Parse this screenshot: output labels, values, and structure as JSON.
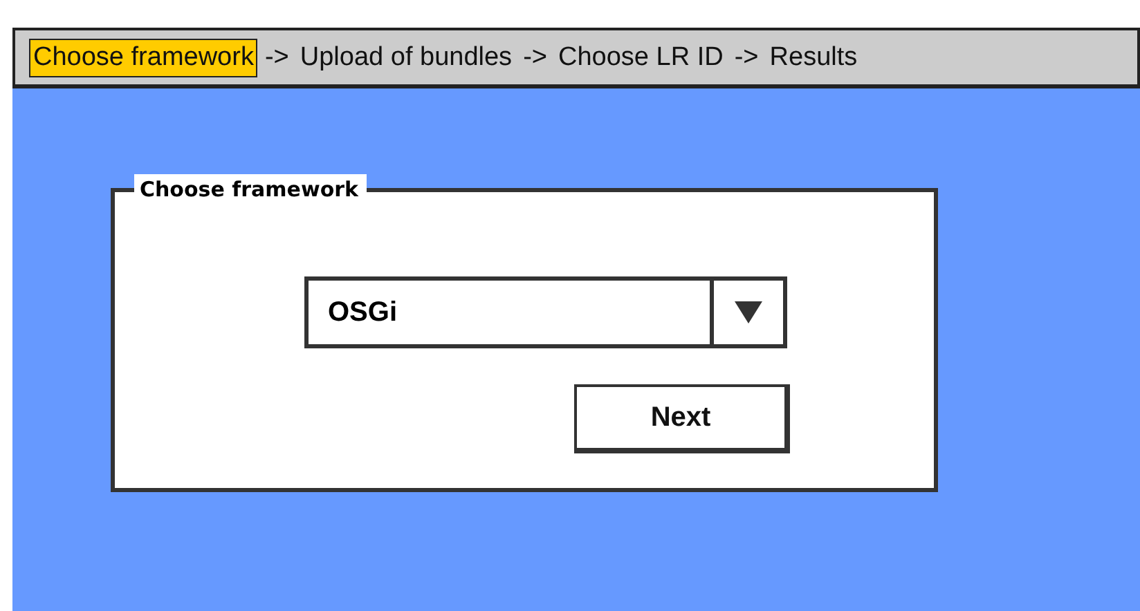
{
  "steps": [
    {
      "label": "Choose framework",
      "selected": true,
      "arrow_after": "->"
    },
    {
      "label": "Upload of bundles",
      "selected": false,
      "arrow_after": "->"
    },
    {
      "label": "Choose LR ID",
      "selected": false,
      "arrow_after": "->"
    },
    {
      "label": "Results",
      "selected": false
    }
  ],
  "panel": {
    "title": "Choose framework",
    "dropdown": {
      "value": "OSGi"
    },
    "button": "Next"
  }
}
